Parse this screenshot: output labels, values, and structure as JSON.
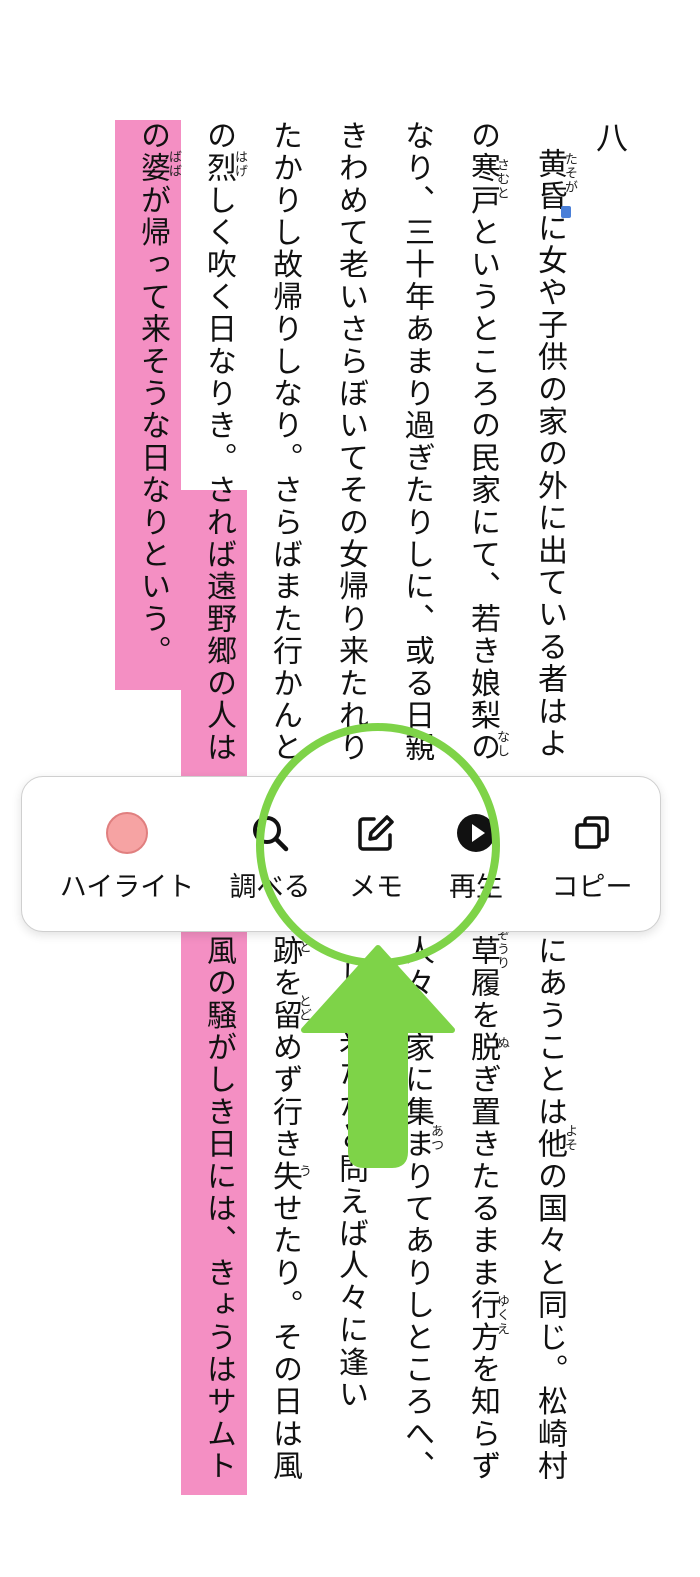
{
  "chapter": "八",
  "columns": [
    "黄昏に女や子供の家の外に出ている者はよ",
    "の寒戸というところの民家にて、若き娘梨の",
    "なり、三十年あまり過ぎたりしに、或る日親",
    "きわめて老いさらぼいてその女帰り来たれり",
    "たかりし故帰りしなり。さらばまた行かんと",
    "の烈しく吹く日なりき。されば遠野郷の人は",
    "の婆が帰って来そうな日なりという。"
  ],
  "lower_columns": [
    "にあうことは他の国々と同じ。松崎村",
    "草履を脱ぎ置きたるまま行方を知らず",
    "人々の家に集まりてありしところへ、",
    "して来たかと問えば人々に逢い",
    "跡を留めず行き失せたり。その日は風",
    "風の騒がしき日には、きょうはサムト"
  ],
  "ruby": {
    "tasogare": "たそが",
    "samuto": "さむと",
    "hage": "はげ",
    "baba": "ばば",
    "nashi": "なし",
    "zouri": "ぞうり",
    "nu": "ぬ",
    "yoso": "よそ",
    "atsu": "あつ",
    "yukue": "ゆくえ",
    "to": "と",
    "todo": "とど",
    "u": "う"
  },
  "popup": {
    "items": [
      {
        "label": "ハイライト",
        "icon": "highlight-circle-icon"
      },
      {
        "label": "調べる",
        "icon": "search-icon"
      },
      {
        "label": "メモ",
        "icon": "memo-edit-icon"
      },
      {
        "label": "再生",
        "icon": "play-icon"
      },
      {
        "label": "コピー",
        "icon": "copy-icon"
      }
    ]
  },
  "colors": {
    "highlight": "#f48fc3",
    "highlight_swatch": "#f6a3a3",
    "annotation": "#7ed348"
  }
}
